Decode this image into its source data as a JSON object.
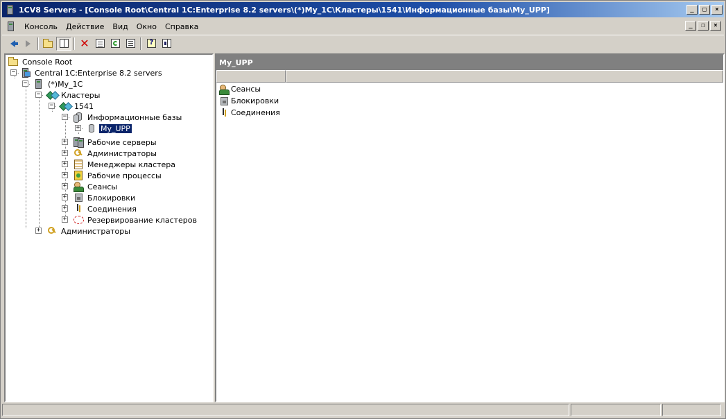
{
  "window": {
    "title": "1CV8 Servers - [Console Root\\Central 1C:Enterprise 8.2 servers\\(*)My_1C\\Кластеры\\1541\\Информационные базы\\My_UPP]",
    "caption_buttons": {
      "minimize": "_",
      "maximize": "□",
      "close": "×"
    }
  },
  "menubar": {
    "items": [
      {
        "label": "Консоль"
      },
      {
        "label": "Действие"
      },
      {
        "label": "Вид"
      },
      {
        "label": "Окно"
      },
      {
        "label": "Справка"
      }
    ],
    "mdi_buttons": {
      "minimize": "_",
      "restore": "❐",
      "close": "×"
    }
  },
  "toolbar": {
    "buttons": [
      {
        "icon": "back-arrow-icon"
      },
      {
        "icon": "forward-arrow-icon"
      },
      {
        "icon": "up-folder-icon"
      },
      {
        "icon": "show-hide-tree-icon"
      },
      {
        "icon": "delete-icon"
      },
      {
        "icon": "properties-icon"
      },
      {
        "icon": "refresh-icon"
      },
      {
        "icon": "export-list-icon"
      },
      {
        "icon": "help-icon"
      },
      {
        "icon": "show-hide-action-pane-icon"
      }
    ]
  },
  "tree": {
    "root": "Console Root",
    "servers": "Central 1C:Enterprise 8.2 servers",
    "server": "(*)My_1C",
    "clusters": "Кластеры",
    "cluster": "1541",
    "infobases": "Информационные базы",
    "infobase_selected": "My_UPP",
    "working_servers": "Рабочие серверы",
    "cluster_admins": "Администраторы",
    "cluster_managers": "Менеджеры кластера",
    "working_processes": "Рабочие процессы",
    "sessions": "Сеансы",
    "locks": "Блокировки",
    "connections": "Соединения",
    "cluster_reservation": "Резервирование кластеров",
    "central_admins": "Администраторы"
  },
  "content": {
    "header": "My_UPP",
    "items": [
      {
        "label": "Сеансы",
        "icon": "sessions-icon"
      },
      {
        "label": "Блокировки",
        "icon": "locks-icon"
      },
      {
        "label": "Соединения",
        "icon": "connections-icon"
      }
    ]
  }
}
